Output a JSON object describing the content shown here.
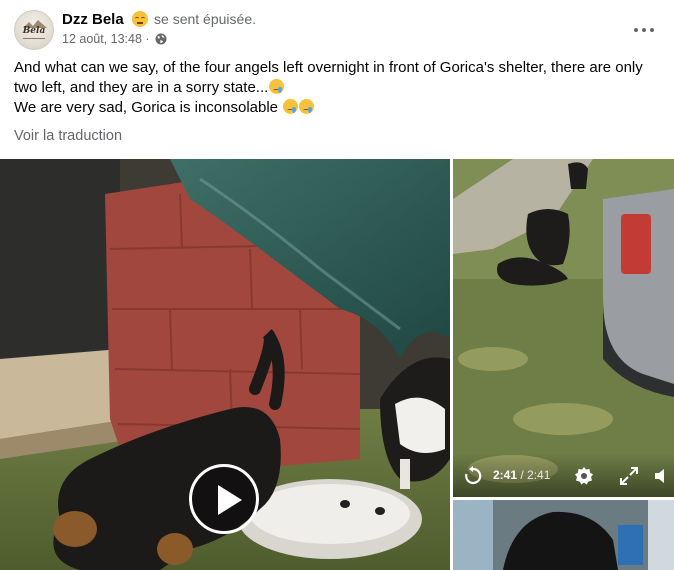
{
  "post": {
    "author": "Dzz Bela",
    "feeling": "se sent épuisée.",
    "timestamp": "12 août, 13:48 ·",
    "avatar_text": "Bela",
    "text_line1": "And what can we say, of the four angels left overnight in front of Gorica's shelter, there are only two left, and they are in a sorry state...",
    "text_line2": "We are very sad, Gorica is inconsolable",
    "translate_label": "Voir la traduction"
  },
  "video": {
    "current_time": "2:41",
    "separator": " / ",
    "duration": "2:41"
  },
  "icons": {
    "privacy": "globe-icon",
    "menu": "more-options-icon",
    "play": "play-icon",
    "replay": "replay-icon",
    "settings": "gear-icon",
    "fullscreen": "fullscreen-icon",
    "volume": "volume-icon"
  },
  "colors": {
    "secondary_text": "#65676b",
    "primary_text": "#050505",
    "emoji_yellow": "#f7c23a"
  }
}
